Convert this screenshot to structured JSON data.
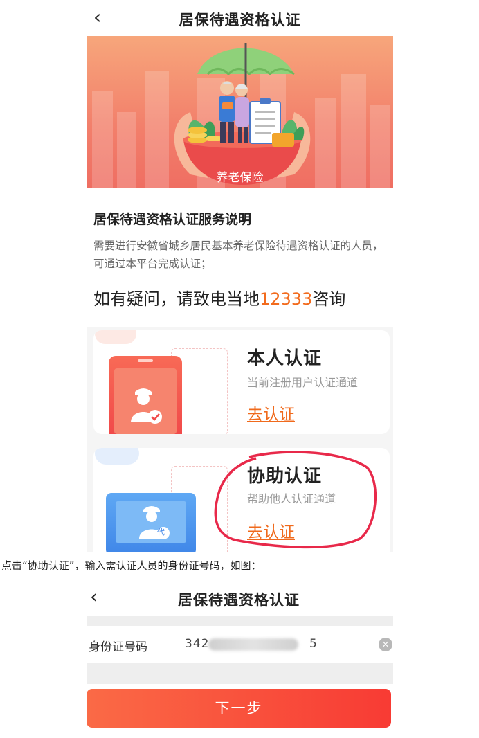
{
  "screen1": {
    "nav": {
      "back_icon": "‹",
      "title": "居保待遇资格认证"
    },
    "banner": {
      "label": "养老保险"
    },
    "intro": {
      "title": "居保待遇资格认证服务说明",
      "body": "需要进行安徽省城乡居民基本养老保险待遇资格认证的人员，可通过本平台完成认证；",
      "ask_prefix": "如有疑问，请致电当地",
      "ask_phone": "12333",
      "ask_suffix": "咨询"
    },
    "cards": [
      {
        "title": "本人认证",
        "subtitle": "当前注册用户认证通道",
        "link": "去认证"
      },
      {
        "title": "协助认证",
        "subtitle": "帮助他人认证通道",
        "link": "去认证",
        "badge": "代"
      }
    ]
  },
  "caption": "点击“协助认证”，输入需认证人员的身份证号码，如图：",
  "screen2": {
    "nav": {
      "back_icon": "‹",
      "title": "居保待遇资格认证"
    },
    "id_label": "身份证号码",
    "id_value_start": "342",
    "id_value_end": "5",
    "clear_icon": "×",
    "next_button": "下一步"
  },
  "colors": {
    "accent": "#f06a1c",
    "button": "#f83b34",
    "highlight_circle": "#e8294a"
  }
}
